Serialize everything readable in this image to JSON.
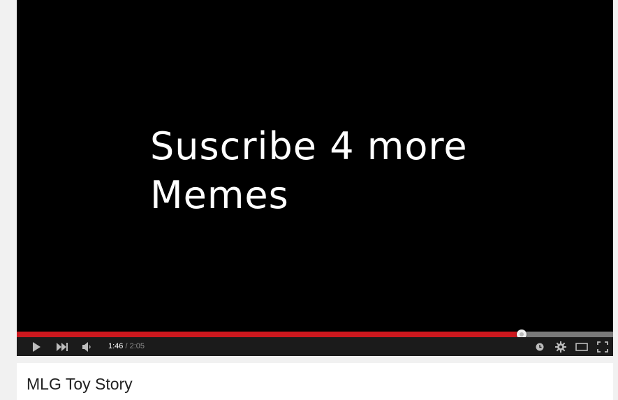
{
  "video": {
    "caption_line1": "Suscribe 4 more",
    "caption_line2": "Memes"
  },
  "player": {
    "progress_fraction": 0.8468,
    "current_time": "1:46",
    "separator": " / ",
    "duration": "2:05",
    "colors": {
      "progress": "#cc181e",
      "controls_bg": "#1b1b1b"
    },
    "icons": [
      "play-icon",
      "next-icon",
      "volume-icon",
      "watch-later-icon",
      "settings-icon",
      "theater-mode-icon",
      "fullscreen-icon"
    ]
  },
  "info": {
    "title": "MLG Toy Story"
  }
}
